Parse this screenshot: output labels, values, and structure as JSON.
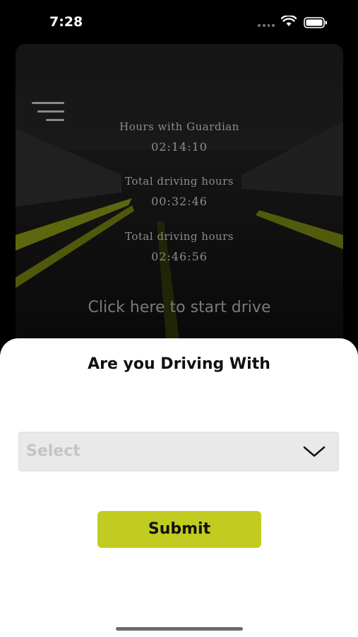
{
  "status_bar": {
    "time": "7:28"
  },
  "dashboard": {
    "stats": [
      {
        "label": "Hours with Guardian",
        "value": "02:14:10"
      },
      {
        "label": "Total driving hours",
        "value": "00:32:46"
      },
      {
        "label": "Total driving hours",
        "value": "02:46:56"
      }
    ],
    "start_drive_label": "Click here to start drive"
  },
  "sheet": {
    "title": "Are you Driving With",
    "select_placeholder": "Select",
    "submit_label": "Submit"
  },
  "colors": {
    "accent": "#c2cb1f",
    "sheet_background": "#ffffff",
    "select_background": "#e9e9e9"
  },
  "icons": {
    "menu": "hamburger-menu-icon",
    "dropdown": "chevron-down-icon",
    "wifi": "wifi-icon",
    "battery": "battery-icon"
  }
}
